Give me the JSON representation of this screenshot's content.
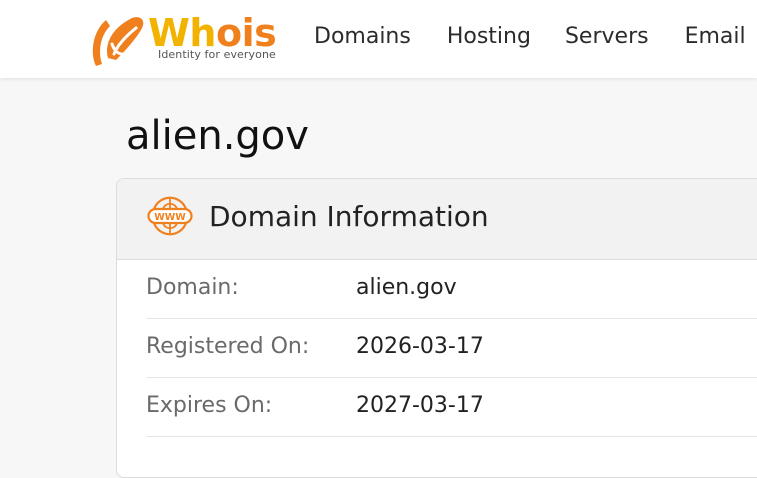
{
  "brand": {
    "name_part1": "Wh",
    "name_part2": "ois",
    "tagline": "Identity for everyone",
    "colors": {
      "yellow": "#f2b300",
      "orange": "#f0801e"
    }
  },
  "nav": {
    "items": [
      {
        "label": "Domains"
      },
      {
        "label": "Hosting"
      },
      {
        "label": "Servers"
      },
      {
        "label": "Email"
      }
    ]
  },
  "page": {
    "title": "alien.gov"
  },
  "domain_info": {
    "icon": "www-icon",
    "title": "Domain Information",
    "rows": [
      {
        "label": "Domain:",
        "value": "alien.gov"
      },
      {
        "label": "Registered On:",
        "value": "2026-03-17"
      },
      {
        "label": "Expires On:",
        "value": "2027-03-17"
      }
    ]
  }
}
